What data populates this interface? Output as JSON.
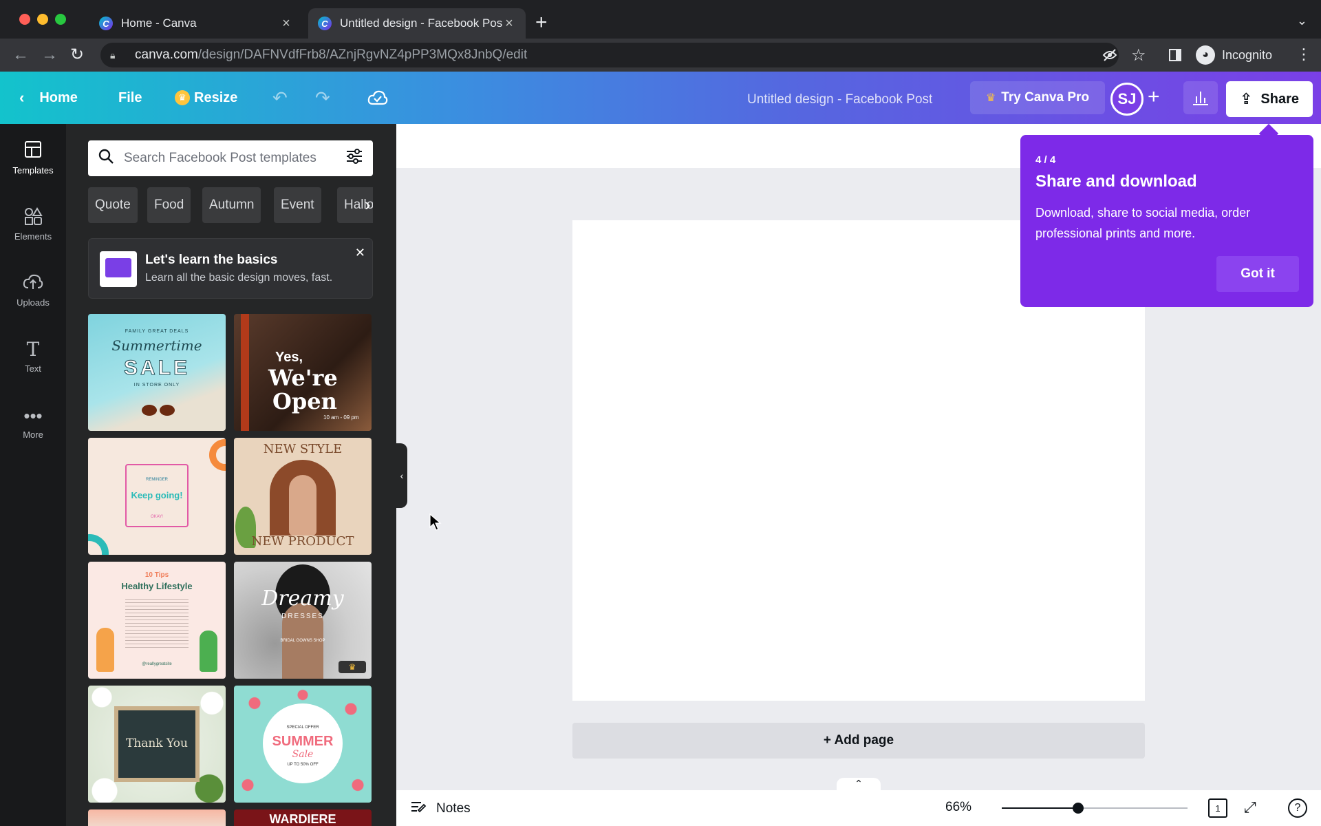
{
  "browser": {
    "tabs": [
      {
        "title": "Home - Canva",
        "active": false
      },
      {
        "title": "Untitled design - Facebook Post",
        "active": true
      }
    ],
    "url_domain": "canva.com",
    "url_path": "/design/DAFNVdfFrb8/AZnjRgvNZ4pPP3MQx8JnbQ/edit",
    "profile_label": "Incognito"
  },
  "header": {
    "home_label": "Home",
    "file_label": "File",
    "resize_label": "Resize",
    "design_title": "Untitled design - Facebook Post",
    "try_pro_label": "Try Canva Pro",
    "avatar_initials": "SJ",
    "share_label": "Share"
  },
  "rail": {
    "items": [
      {
        "label": "Templates",
        "icon": "template-icon"
      },
      {
        "label": "Elements",
        "icon": "elements-icon"
      },
      {
        "label": "Uploads",
        "icon": "upload-icon"
      },
      {
        "label": "Text",
        "icon": "text-icon"
      },
      {
        "label": "More",
        "icon": "more-icon"
      }
    ]
  },
  "panel": {
    "search_placeholder": "Search Facebook Post templates",
    "chips": [
      "Quote",
      "Food",
      "Autumn",
      "Event",
      "Hallo"
    ],
    "learn_title": "Let's learn the basics",
    "learn_subtitle": "Learn all the basic design moves, fast.",
    "templates": {
      "t1_line1": "FAMILY GREAT DEALS",
      "t1_script": "Summertime",
      "t1_big": "SALE",
      "t1_small": "IN STORE ONLY",
      "t2_line1": "Yes,",
      "t2_line2": "We're",
      "t2_line3": "Open",
      "t2_hours": "10 am - 09 pm",
      "t3_top": "REMINDER",
      "t3_main": "Keep going!",
      "t3_bottom": "OKAY!",
      "t4_top": "NEW STYLE",
      "t4_bottom": "NEW PRODUCT",
      "t5_top": "10 Tips",
      "t5_main": "Healthy Lifestyle",
      "t5_handle": "@reallygreatsite",
      "t6_script": "Dreamy",
      "t6_sub": "DRESSES",
      "t6_small": "BRIDAL GOWNS SHOP",
      "t7_main": "Thank You",
      "t8_top": "SPECIAL OFFER",
      "t8_main": "SUMMER",
      "t8_script": "Sale",
      "t8_small": "UP TO 50% OFF",
      "t10_main": "WARDIERE"
    }
  },
  "canvas": {
    "add_page_label": "+ Add page"
  },
  "footer": {
    "notes_label": "Notes",
    "zoom_label": "66%",
    "zoom_value": 0.66,
    "page_number": "1"
  },
  "popover": {
    "step": "4 / 4",
    "title": "Share and download",
    "description": "Download, share to social media, order professional prints and more.",
    "button_label": "Got it"
  },
  "colors": {
    "accent_purple": "#7d2ae8",
    "header_start": "#13c3cc",
    "header_end": "#7a3fe6"
  }
}
